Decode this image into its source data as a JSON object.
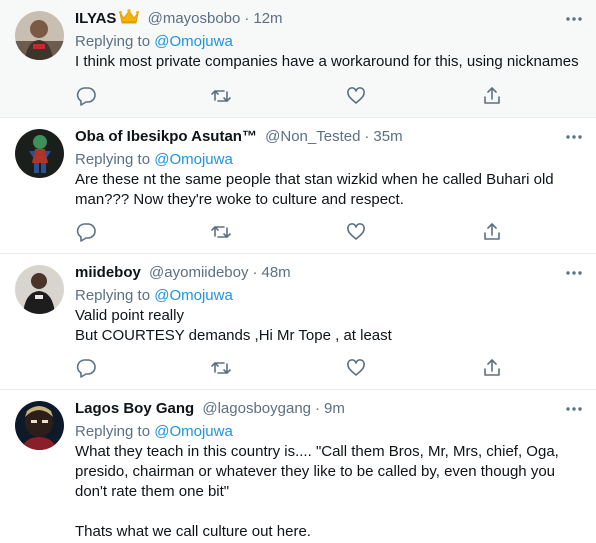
{
  "tweets": [
    {
      "name": "ILYAS",
      "badge": "crown-emoji",
      "handle": "@mayosbobo",
      "separator": "·",
      "time": "12m",
      "reply_prefix": "Replying to",
      "reply_to": "@Omojuwa",
      "text": "I think most private companies have a workaround for this, using nicknames",
      "avatar_color": "#8a7a6a"
    },
    {
      "name": "Oba of Ibesikpo Asutan™",
      "handle": "@Non_Tested",
      "separator": "·",
      "time": "35m",
      "reply_prefix": "Replying to",
      "reply_to": "@Omojuwa",
      "text": "Are these nt the same people that stan wizkid when he called Buhari old man??? Now they're woke to culture and respect.",
      "avatar_color": "#2f6a4a"
    },
    {
      "name": "miideboy",
      "handle": "@ayomiideboy",
      "separator": "·",
      "time": "48m",
      "reply_prefix": "Replying to",
      "reply_to": "@Omojuwa",
      "text": "Valid point really\nBut COURTESY demands ,Hi Mr Tope , at least",
      "avatar_color": "#c9c4bd"
    },
    {
      "name": "Lagos Boy Gang",
      "handle": "@lagosboygang",
      "separator": "·",
      "time": "9m",
      "reply_prefix": "Replying to",
      "reply_to": "@Omojuwa",
      "text": "What they teach in this country is.... \"Call them Bros, Mr, Mrs, chief, Oga, presido, chairman or whatever they like to be called by, even though you don't rate them one bit\"\n\nThats what we call culture out here.",
      "avatar_color": "#3a2a22"
    }
  ],
  "icons": {
    "reply": "comment-icon",
    "retweet": "retweet-icon",
    "like": "heart-icon",
    "share": "share-icon",
    "more": "more-icon"
  },
  "colors": {
    "text": "#0f1419",
    "secondary": "#5b7083",
    "mention": "#1b95e0",
    "divider": "#e6ecf0",
    "highlight_bg": "#f7f9f9"
  }
}
